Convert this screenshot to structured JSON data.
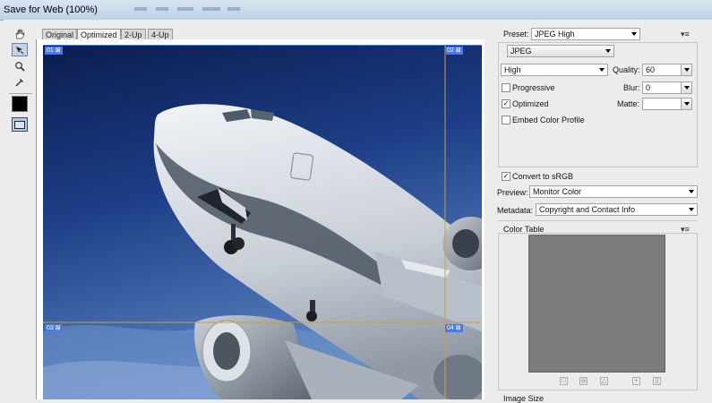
{
  "window": {
    "title": "Save for Web (100%)"
  },
  "tools": [
    {
      "name": "hand-tool-icon",
      "glyph": "✋"
    },
    {
      "name": "slice-select-tool-icon",
      "glyph": "↗"
    },
    {
      "name": "zoom-tool-icon",
      "glyph": "⚲"
    },
    {
      "name": "eyedropper-tool-icon",
      "glyph": "✎"
    }
  ],
  "eyedropper_color": "#000000",
  "tabs": [
    "Original",
    "Optimized",
    "2-Up",
    "4-Up"
  ],
  "active_tab": "Optimized",
  "slices": [
    "01",
    "02",
    "03",
    "04"
  ],
  "settings": {
    "preset_label": "Preset:",
    "preset_value": "JPEG High",
    "format_value": "JPEG",
    "quality_preset": "High",
    "quality_label": "Quality:",
    "quality_value": "60",
    "blur_label": "Blur:",
    "blur_value": "0",
    "matte_label": "Matte:",
    "matte_value": "",
    "progressive_label": "Progressive",
    "progressive_checked": false,
    "optimized_label": "Optimized",
    "optimized_checked": true,
    "embed_profile_label": "Embed Color Profile",
    "embed_profile_checked": false,
    "convert_srgb_label": "Convert to sRGB",
    "convert_srgb_checked": true,
    "preview_label": "Preview:",
    "preview_value": "Monitor Color",
    "metadata_label": "Metadata:",
    "metadata_value": "Copyright and Contact Info",
    "panel_menu_glyph": "▾≡"
  },
  "color_table": {
    "title": "Color Table",
    "swatch_color": "#7c7c7c",
    "icons": [
      "snap-to-web-icon",
      "lock-color-icon",
      "shift-color-icon",
      "new-color-icon",
      "delete-color-icon"
    ]
  },
  "image_size": {
    "title": "Image Size"
  }
}
